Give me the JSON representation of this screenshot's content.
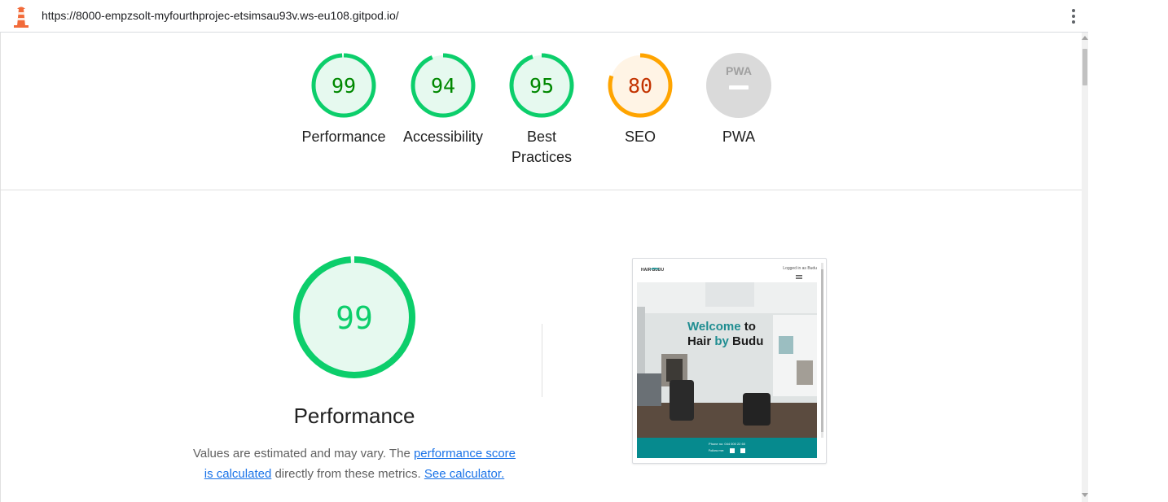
{
  "address_bar": {
    "url": "https://8000-empzsolt-myfourthprojec-etsimsau93v.ws-eu108.gitpod.io/",
    "lighthouse_icon": "lighthouse-icon",
    "menu_icon": "more-vert-icon"
  },
  "gauges": [
    {
      "score": "99",
      "label": "Performance",
      "value": 99,
      "color": "#0cce6b",
      "text_color": "#008800",
      "fill": "#e6f9ef"
    },
    {
      "score": "94",
      "label": "Accessibility",
      "value": 94,
      "color": "#0cce6b",
      "text_color": "#008800",
      "fill": "#e6f9ef"
    },
    {
      "score": "95",
      "label_line1": "Best",
      "label_line2": "Practices",
      "value": 95,
      "color": "#0cce6b",
      "text_color": "#008800",
      "fill": "#e6f9ef"
    },
    {
      "score": "80",
      "label": "SEO",
      "value": 80,
      "color": "#ffa400",
      "text_color": "#c33300",
      "fill": "#fff4e5"
    },
    {
      "badge": "PWA",
      "label": "PWA",
      "color": "#cccccc"
    }
  ],
  "performance": {
    "score": "99",
    "value": 99,
    "title": "Performance",
    "desc_part1": "Values are estimated and may vary. The ",
    "link_score": "performance score is calculated",
    "desc_part2": " directly from these metrics. ",
    "link_calc": "See calculator."
  },
  "screenshot": {
    "logo": "HAIR BUDU",
    "login_text": "Logged in as Budu",
    "hero_title_1": "Welcome",
    "hero_title_2": " to",
    "hero_title_3": "Hair ",
    "hero_title_4": "by",
    "hero_title_5": " Budu",
    "footer_phone": "Phone no: 044 000 22 60",
    "footer_follow": "Follow me:"
  }
}
